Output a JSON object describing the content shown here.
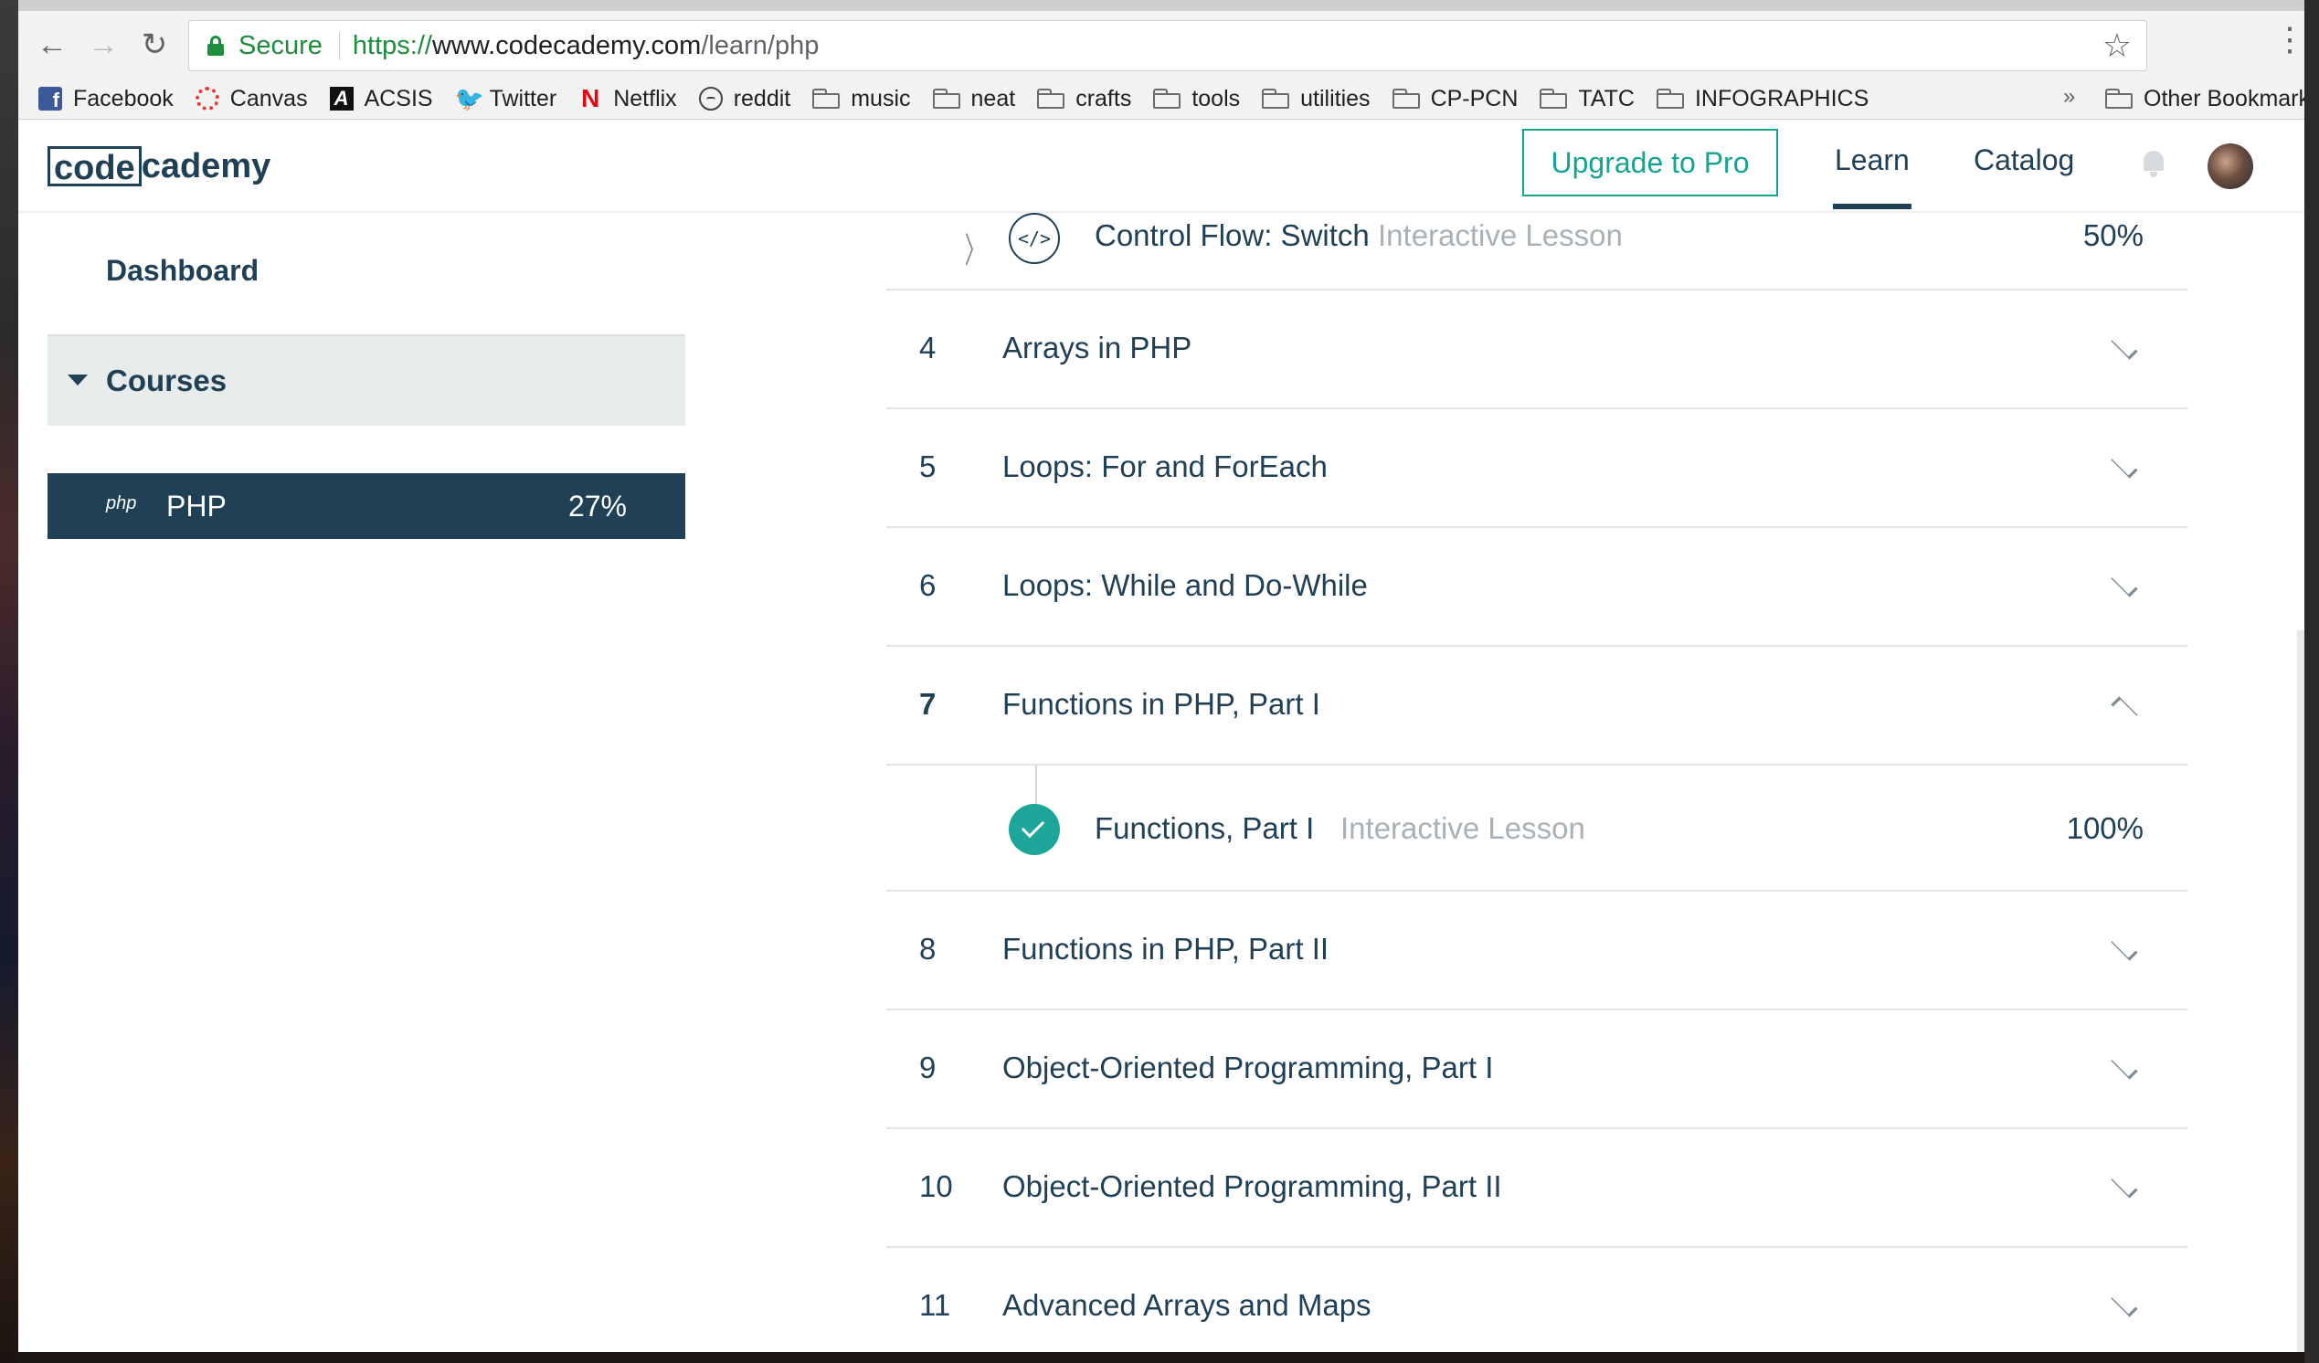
{
  "browser": {
    "secure_label": "Secure",
    "url_scheme": "https://",
    "url_host": "www.codecademy.com",
    "url_path": "/learn/php",
    "bookmarks": [
      {
        "label": "Facebook",
        "icon": "facebook-icon"
      },
      {
        "label": "Canvas",
        "icon": "canvas-icon"
      },
      {
        "label": "ACSIS",
        "icon": "acsis-icon"
      },
      {
        "label": "Twitter",
        "icon": "twitter-icon"
      },
      {
        "label": "Netflix",
        "icon": "netflix-icon"
      },
      {
        "label": "reddit",
        "icon": "reddit-icon"
      },
      {
        "label": "music",
        "icon": "folder-icon"
      },
      {
        "label": "neat",
        "icon": "folder-icon"
      },
      {
        "label": "crafts",
        "icon": "folder-icon"
      },
      {
        "label": "tools",
        "icon": "folder-icon"
      },
      {
        "label": "utilities",
        "icon": "folder-icon"
      },
      {
        "label": "CP-PCN",
        "icon": "folder-icon"
      },
      {
        "label": "TATC",
        "icon": "folder-icon"
      },
      {
        "label": "INFOGRAPHICS",
        "icon": "folder-icon"
      }
    ],
    "more_bookmarks": "»",
    "other_bookmarks": "Other Bookmarks"
  },
  "header": {
    "logo_code": "code",
    "logo_rest": "cademy",
    "upgrade_label": "Upgrade to Pro",
    "nav": {
      "learn": "Learn",
      "catalog": "Catalog"
    }
  },
  "sidebar": {
    "dashboard": "Dashboard",
    "courses": "Courses",
    "course": {
      "logo": "php",
      "name": "PHP",
      "progress": "27%"
    }
  },
  "lessons": {
    "switch": {
      "icon": "</>",
      "title": "Control Flow: Switch",
      "type": "Interactive Lesson",
      "progress": "50%"
    },
    "functions_part1": {
      "title": "Functions, Part I",
      "type": "Interactive Lesson",
      "progress": "100%",
      "completed": true
    }
  },
  "units": [
    {
      "num": "4",
      "title": "Arrays in PHP",
      "expanded": false
    },
    {
      "num": "5",
      "title": "Loops: For and ForEach",
      "expanded": false
    },
    {
      "num": "6",
      "title": "Loops: While and Do-While",
      "expanded": false
    },
    {
      "num": "7",
      "title": "Functions in PHP, Part I",
      "expanded": true
    },
    {
      "num": "8",
      "title": "Functions in PHP, Part II",
      "expanded": false
    },
    {
      "num": "9",
      "title": "Object-Oriented Programming, Part I",
      "expanded": false
    },
    {
      "num": "10",
      "title": "Object-Oriented Programming, Part II",
      "expanded": false
    },
    {
      "num": "11",
      "title": "Advanced Arrays and Maps",
      "expanded": false
    }
  ],
  "colors": {
    "brand_navy": "#204056",
    "accent_teal": "#15a492",
    "complete_green": "#1fa69b",
    "muted_text": "#a7b1b7"
  }
}
